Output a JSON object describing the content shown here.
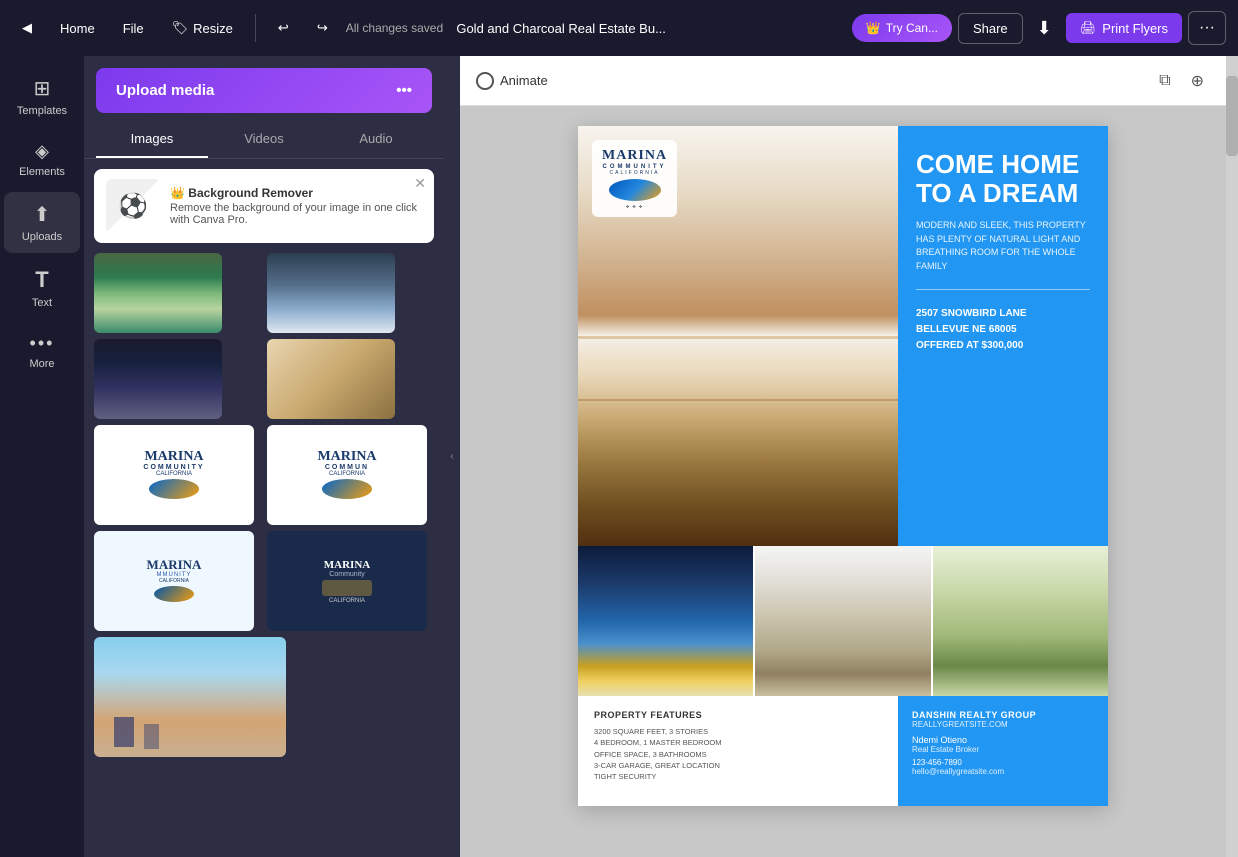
{
  "topbar": {
    "home_label": "Home",
    "file_label": "File",
    "resize_label": "Resize",
    "saved_label": "All changes saved",
    "doc_title": "Gold and Charcoal Real Estate Bu...",
    "try_can_label": "Try Can...",
    "share_label": "Share",
    "print_label": "Print Flyers",
    "more_label": "···"
  },
  "sidebar": {
    "items": [
      {
        "id": "templates",
        "label": "Templates",
        "icon": "⊞"
      },
      {
        "id": "elements",
        "label": "Elements",
        "icon": "◇"
      },
      {
        "id": "uploads",
        "label": "Uploads",
        "icon": "↑"
      },
      {
        "id": "text",
        "label": "Text",
        "icon": "T"
      },
      {
        "id": "more",
        "label": "More",
        "icon": "···"
      }
    ]
  },
  "panel": {
    "upload_btn_label": "Upload media",
    "upload_more_label": "···",
    "tabs": [
      "Images",
      "Videos",
      "Audio"
    ],
    "active_tab": "Images",
    "bg_remover": {
      "title": "Background Remover",
      "description": "Remove the background of your image in one click with Canva Pro.",
      "crown": "👑"
    }
  },
  "canvas": {
    "animate_label": "Animate",
    "toolbar_icons": [
      "copy",
      "add"
    ]
  },
  "flyer": {
    "heading_line1": "COME HOME",
    "heading_line2": "TO A DREAM",
    "subtext": "MODERN AND SLEEK, THIS PROPERTY HAS PLENTY OF NATURAL LIGHT AND BREATHING ROOM FOR THE WHOLE FAMILY",
    "address_line1": "2507 SNOWBIRD LANE",
    "address_line2": "BELLEVUE NE 68005",
    "address_line3": "OFFERED AT $300,000",
    "features_title": "PROPERTY FEATURES",
    "features": [
      "3200 SQUARE FEET, 3 STORIES",
      "4 BEDROOM, 1 MASTER BEDROOM",
      "OFFICE SPACE, 3 BATHROOMS",
      "3-CAR GARAGE, GREAT LOCATION",
      "TIGHT SECURITY"
    ],
    "agent_company": "DANSHIN REALTY GROUP",
    "agent_site": "REALLYGREATSITE.COM",
    "agent_name": "Ndemi Otieno",
    "agent_title": "Real Estate Broker",
    "agent_phone": "123-456-7890",
    "agent_email": "hello@reallygreatsite.com"
  }
}
